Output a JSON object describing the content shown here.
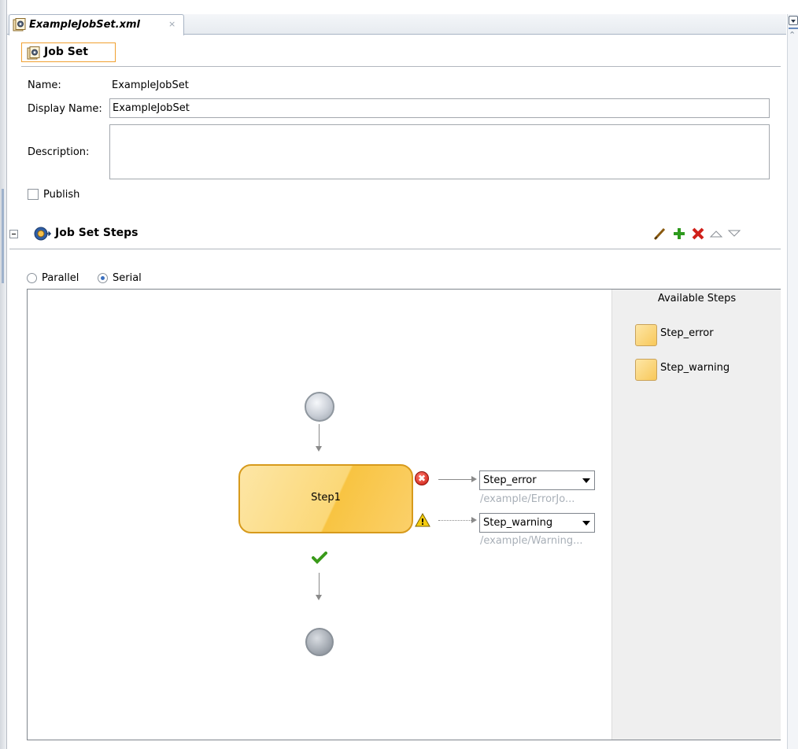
{
  "tab": {
    "title": "ExampleJobSet.xml",
    "close": "×"
  },
  "section": {
    "title": "Job Set"
  },
  "form": {
    "name_label": "Name:",
    "name_value": "ExampleJobSet",
    "display_name_label": "Display Name:",
    "display_name_value": "ExampleJobSet",
    "description_label": "Description:",
    "description_value": "",
    "publish_label": "Publish",
    "publish_checked": false
  },
  "steps_section": {
    "title": "Job Set Steps",
    "toolbar": [
      {
        "name": "edit-icon",
        "glyph": "╱",
        "color": "#c07010"
      },
      {
        "name": "add-icon",
        "glyph": "✚",
        "color": "#2e9a1e"
      },
      {
        "name": "delete-icon",
        "glyph": "✖",
        "color": "#d0201a"
      },
      {
        "name": "move-up-icon",
        "glyph": "△",
        "color": "#8a8f96"
      },
      {
        "name": "move-down-icon",
        "glyph": "▽",
        "color": "#8a8f96"
      }
    ],
    "mode": {
      "parallel_label": "Parallel",
      "serial_label": "Serial",
      "selected": "Serial"
    }
  },
  "diagram": {
    "step_label": "Step1",
    "error_badge": "✖",
    "warning_badge": "!",
    "success_mark": "✔",
    "error_target": {
      "value": "Step_error",
      "path": "/example/ErrorJo..."
    },
    "warning_target": {
      "value": "Step_warning",
      "path": "/example/Warning..."
    }
  },
  "available_steps": {
    "title": "Available Steps",
    "items": [
      "Step_error",
      "Step_warning"
    ]
  },
  "colors": {
    "step_fill": "#fbd878",
    "step_border": "#d79a1c",
    "section_outline": "#f0a030",
    "error": "#c8170d",
    "warning": "#f2c200",
    "success": "#3a9a1a"
  }
}
